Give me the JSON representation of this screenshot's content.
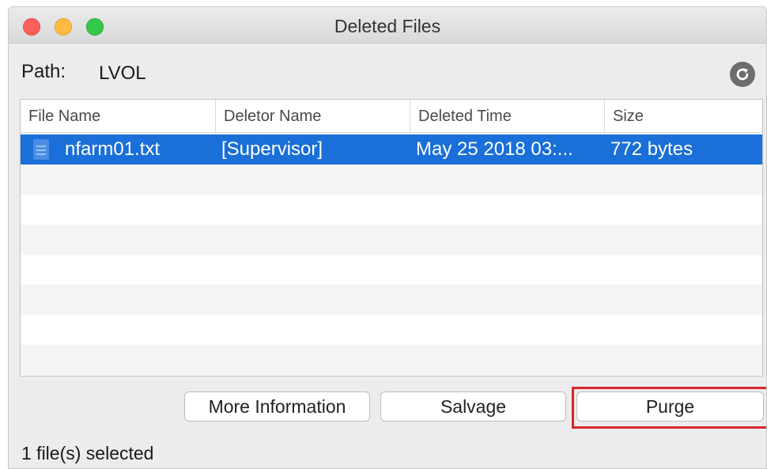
{
  "window": {
    "title": "Deleted Files"
  },
  "path": {
    "label": "Path:",
    "value": "LVOL"
  },
  "table": {
    "columns": [
      "File Name",
      "Deletor Name",
      "Deleted Time",
      "Size"
    ],
    "rows": [
      {
        "file_name": "nfarm01.txt",
        "deletor": "[Supervisor]",
        "deleted_time": "May 25 2018 03:...",
        "size": "772 bytes",
        "selected": true
      }
    ]
  },
  "buttons": {
    "more_info": "More Information",
    "salvage": "Salvage",
    "purge": "Purge"
  },
  "status": "1 file(s) selected",
  "colors": {
    "selection": "#1a6fd8",
    "highlight": "#d8262d"
  },
  "icons": {
    "refresh": "refresh-icon",
    "file": "document-icon"
  }
}
